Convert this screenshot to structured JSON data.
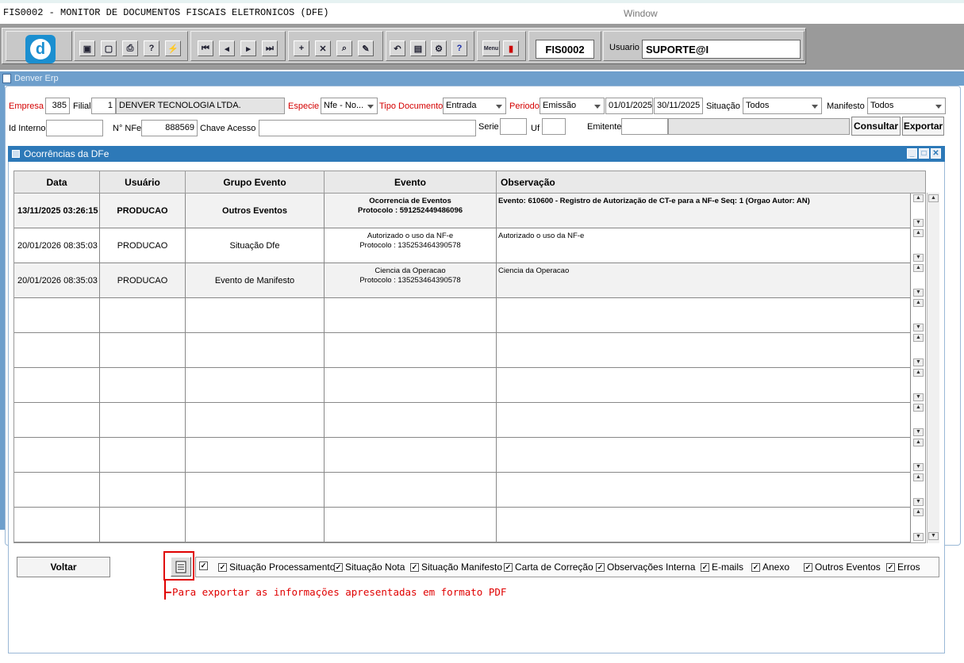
{
  "titlebar": {
    "title": "FIS0002 - MONITOR DE DOCUMENTOS FISCAIS ELETRONICOS (DFE)",
    "window_menu": "Window"
  },
  "toolbar": {
    "logo_letter": "d",
    "form_code": "FIS0002",
    "user_label": "Usuario",
    "user_value": "SUPORTE@I",
    "menu_label": "Menu"
  },
  "erp_bar": {
    "title": "Denver Erp"
  },
  "filters": {
    "empresa_label": "Empresa",
    "empresa_value": "385",
    "filial_label": "Filial",
    "filial_value": "1",
    "company_name": "DENVER TECNOLOGIA LTDA.",
    "especie_label": "Especie",
    "especie_value": "Nfe - No...",
    "tipo_doc_label": "Tipo Documento",
    "tipo_doc_value": "Entrada",
    "periodo_label": "Periodo",
    "periodo_value": "Emissão",
    "date_from": "01/01/2025",
    "date_to": "30/11/2025",
    "situacao_label": "Situação",
    "situacao_value": "Todos",
    "manifesto_label": "Manifesto",
    "manifesto_value": "Todos",
    "id_interno_label": "Id Interno",
    "id_interno_value": "",
    "nnfe_label": "N° NFe",
    "nnfe_value": "888569",
    "chave_label": "Chave Acesso",
    "chave_value": "",
    "serie_label": "Serie",
    "serie_value": "",
    "uf_label": "Uf",
    "uf_value": "",
    "emitente_label": "Emitente",
    "emitente_value": "",
    "consultar_label": "Consultar",
    "exportar_label": "Exportar"
  },
  "dialog": {
    "title": "Ocorrências da DFe",
    "columns": [
      "Data",
      "Usuário",
      "Grupo Evento",
      "Evento",
      "Observação"
    ],
    "rows": [
      {
        "data": "13/11/2025 03:26:15",
        "usuario": "PRODUCAO",
        "grupo": "Outros Eventos",
        "evento_l1": "Ocorrencia de Eventos",
        "evento_l2": "Protocolo : 591252449486096",
        "obs": "Evento: 610600 - Registro de Autorização de CT-e para a NF-e  Seq: 1  (Orgao Autor: AN)",
        "bold": true
      },
      {
        "data": "20/01/2026 08:35:03",
        "usuario": "PRODUCAO",
        "grupo": "Situação Dfe",
        "evento_l1": "Autorizado o uso da NF-e",
        "evento_l2": "Protocolo : 135253464390578",
        "obs": "Autorizado o uso da NF-e",
        "bold": false
      },
      {
        "data": "20/01/2026 08:35:03",
        "usuario": "PRODUCAO",
        "grupo": "Evento de Manifesto",
        "evento_l1": "Ciencia da Operacao",
        "evento_l2": "Protocolo : 135253464390578",
        "obs": "Ciencia da Operacao",
        "bold": false
      }
    ],
    "voltar_label": "Voltar",
    "options": [
      {
        "label": "",
        "checked": true
      },
      {
        "label": "Situação Processamento",
        "checked": true
      },
      {
        "label": "Situação Nota",
        "checked": true
      },
      {
        "label": "Situação Manifesto",
        "checked": true
      },
      {
        "label": "Carta de Correção",
        "checked": true
      },
      {
        "label": "Observações Interna",
        "checked": true
      },
      {
        "label": "E-mails",
        "checked": true
      },
      {
        "label": "Anexo",
        "checked": true
      },
      {
        "label": "Outros Eventos",
        "checked": true
      },
      {
        "label": "Erros",
        "checked": true
      }
    ],
    "callout": "Para exportar as informações apresentadas em formato PDF"
  }
}
